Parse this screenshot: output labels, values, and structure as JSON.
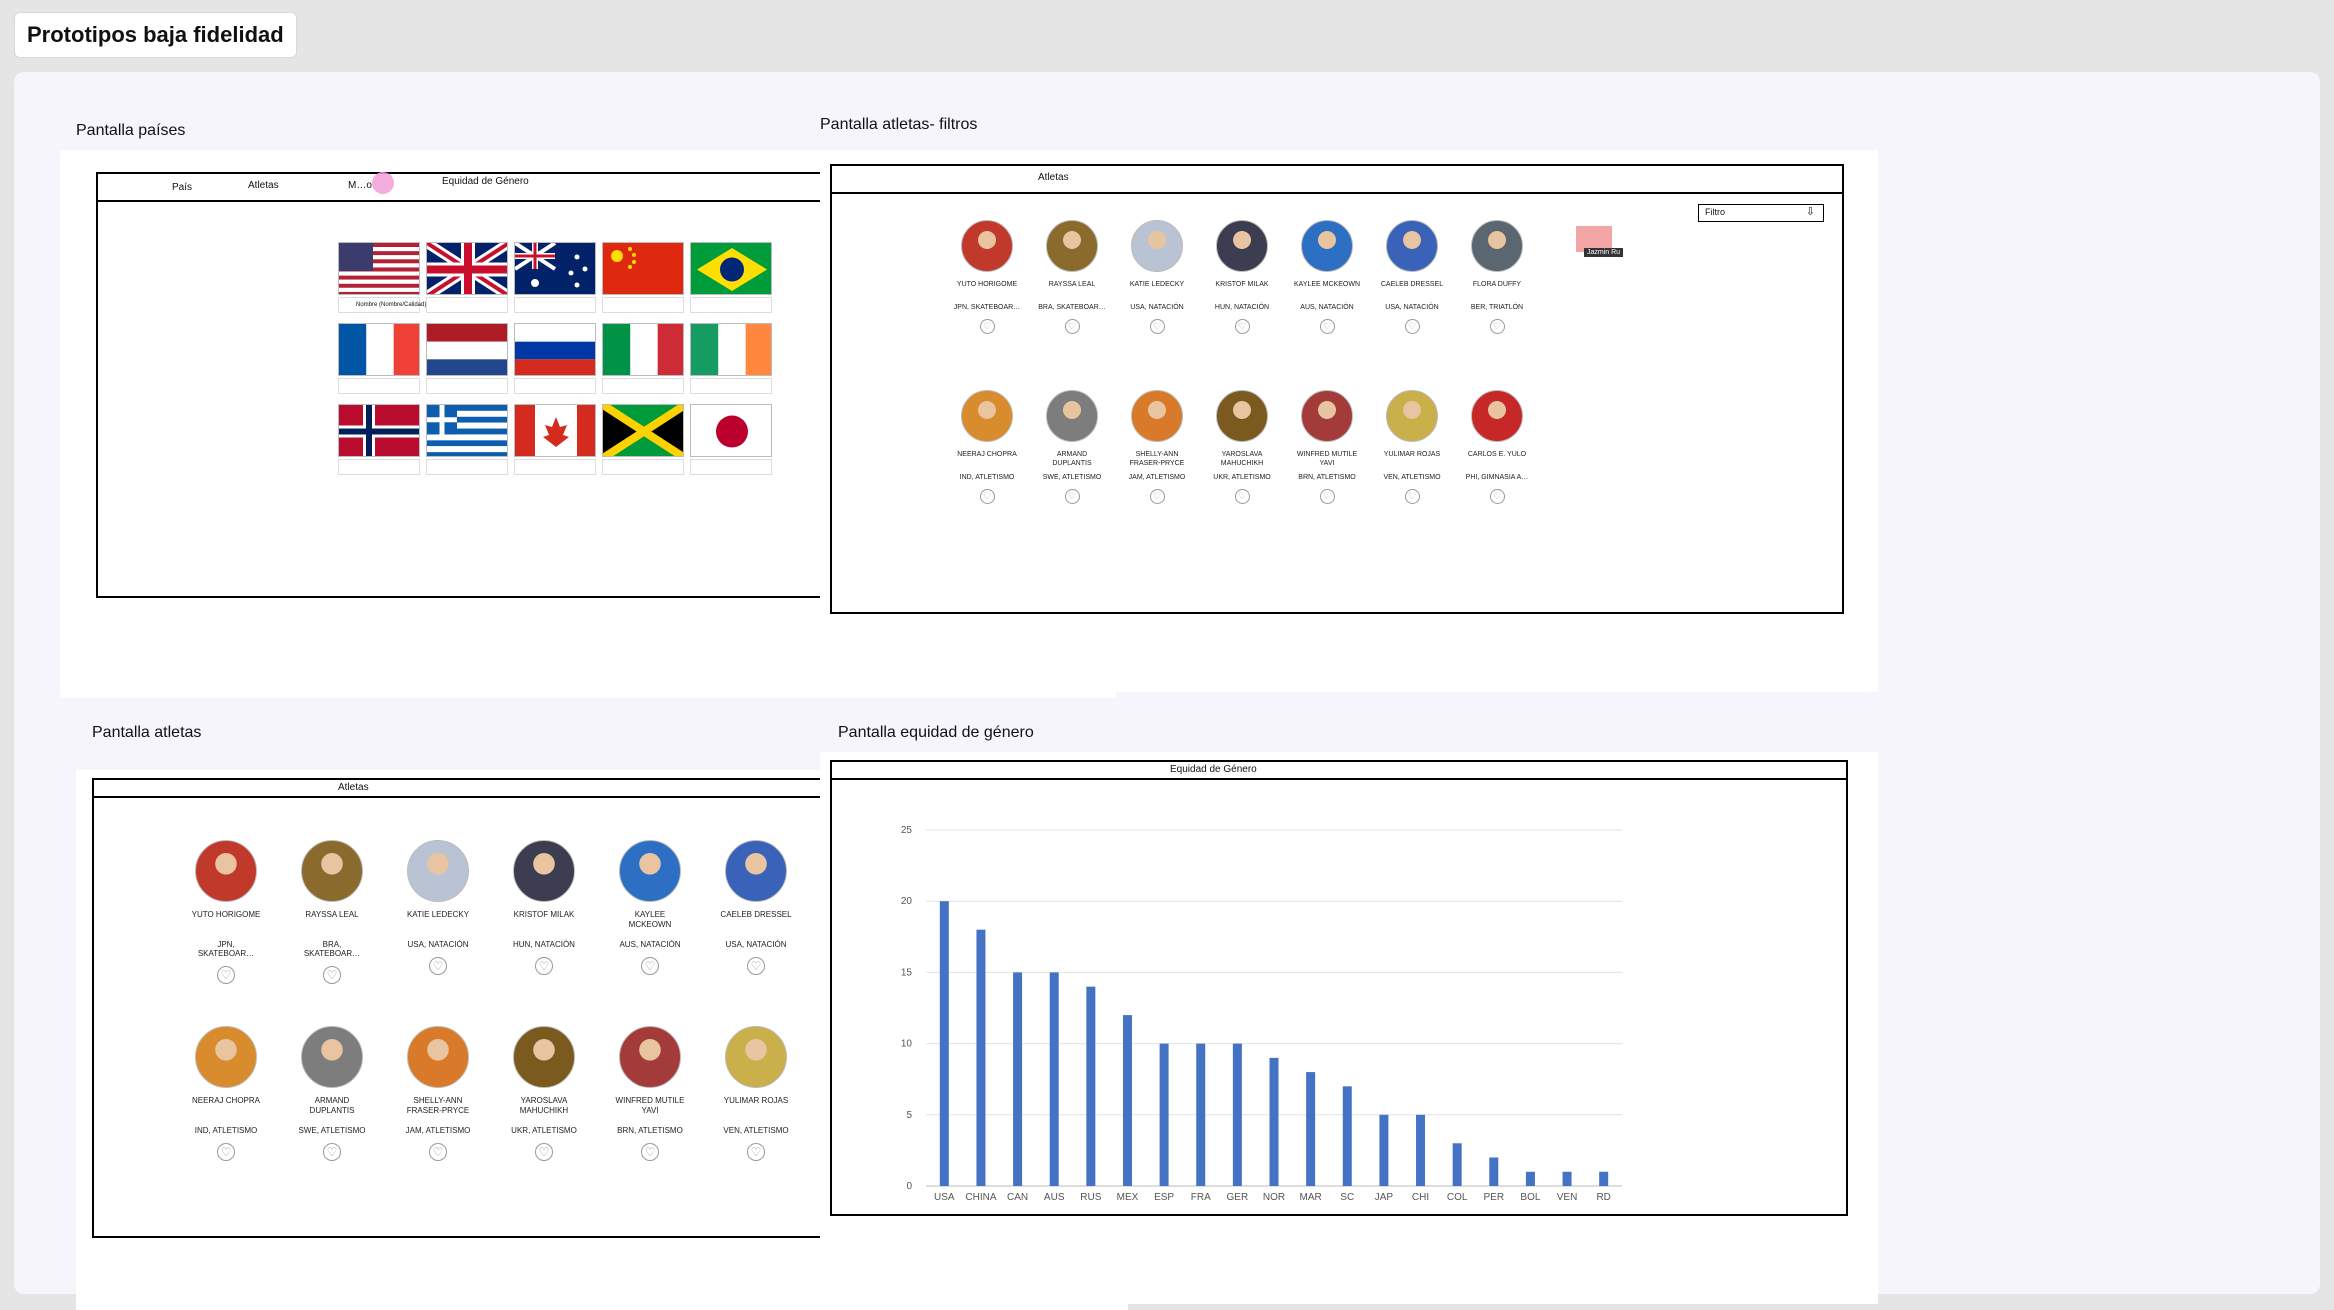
{
  "page": {
    "title": "Prototipos baja fidelidad"
  },
  "sections": {
    "paises": {
      "label": "Pantalla países",
      "nav": [
        "País",
        "Atletas",
        "M…o",
        "Equidad de Género"
      ],
      "flag_hint": "Nombre (Nombre/Calidad)",
      "flags": [
        "usa",
        "uk",
        "australia",
        "china",
        "brazil",
        "france",
        "netherlands",
        "russia",
        "italy",
        "ireland",
        "norway",
        "greece",
        "canada",
        "jamaica",
        "japan"
      ]
    },
    "filtros": {
      "label": "Pantalla atletas- filtros",
      "nav": [
        "Atletas"
      ],
      "filter_label": "Filtro"
    },
    "atletas": {
      "label": "Pantalla atletas",
      "nav": [
        "Atletas"
      ]
    },
    "equidad": {
      "label": "Pantalla equidad de género",
      "nav": [
        "Equidad de Género"
      ]
    }
  },
  "tooltip_label": "Jazmin Ru",
  "athletes": [
    {
      "name": "YUTO HORIGOME",
      "country": "JPN, SKATEBOAR…",
      "color": "#c0392b"
    },
    {
      "name": "RAYSSA LEAL",
      "country": "BRA, SKATEBOAR…",
      "color": "#8a6a2d"
    },
    {
      "name": "KATIE LEDECKY",
      "country": "USA, NATACIÓN",
      "color": "#b9c3d4"
    },
    {
      "name": "KRISTOF MILAK",
      "country": "HUN, NATACIÓN",
      "color": "#3d3d52"
    },
    {
      "name": "KAYLEE MCKEOWN",
      "country": "AUS, NATACIÓN",
      "color": "#2d6fc2"
    },
    {
      "name": "CAELEB DRESSEL",
      "country": "USA, NATACIÓN",
      "color": "#3a62b8"
    },
    {
      "name": "FLORA DUFFY",
      "country": "BER, TRIATLÓN",
      "color": "#5a6770"
    },
    {
      "name": "NEERAJ CHOPRA",
      "country": "IND, ATLETISMO",
      "color": "#d98c2e"
    },
    {
      "name": "ARMAND DUPLANTIS",
      "country": "SWE, ATLETISMO",
      "color": "#7d7d7d"
    },
    {
      "name": "SHELLY-ANN FRASER-PRYCE",
      "country": "JAM, ATLETISMO",
      "color": "#d97a2b"
    },
    {
      "name": "YAROSLAVA MAHUCHIKH",
      "country": "UKR, ATLETISMO",
      "color": "#7a5a1e"
    },
    {
      "name": "WINFRED MUTILE YAVI",
      "country": "BRN, ATLETISMO",
      "color": "#a43b3b"
    },
    {
      "name": "YULIMAR ROJAS",
      "country": "VEN, ATLETISMO",
      "color": "#c9b04a"
    },
    {
      "name": "CARLOS E. YULO",
      "country": "PHI, GIMNASIA A…",
      "color": "#c62828"
    }
  ],
  "chart_data": {
    "type": "bar",
    "title": "",
    "xlabel": "",
    "ylabel": "",
    "categories": [
      "USA",
      "CHINA",
      "CAN",
      "AUS",
      "RUS",
      "MEX",
      "ESP",
      "FRA",
      "GER",
      "NOR",
      "MAR",
      "SC",
      "JAP",
      "CHI",
      "COL",
      "PER",
      "BOL",
      "VEN",
      "RD"
    ],
    "values": [
      20,
      18,
      15,
      15,
      14,
      12,
      10,
      10,
      10,
      9,
      8,
      7,
      5,
      5,
      3,
      2,
      1,
      1,
      1
    ],
    "ylim": [
      0,
      25
    ],
    "yticks": [
      0,
      5,
      10,
      15,
      20,
      25
    ],
    "grid": true,
    "color": "#4472c4"
  }
}
